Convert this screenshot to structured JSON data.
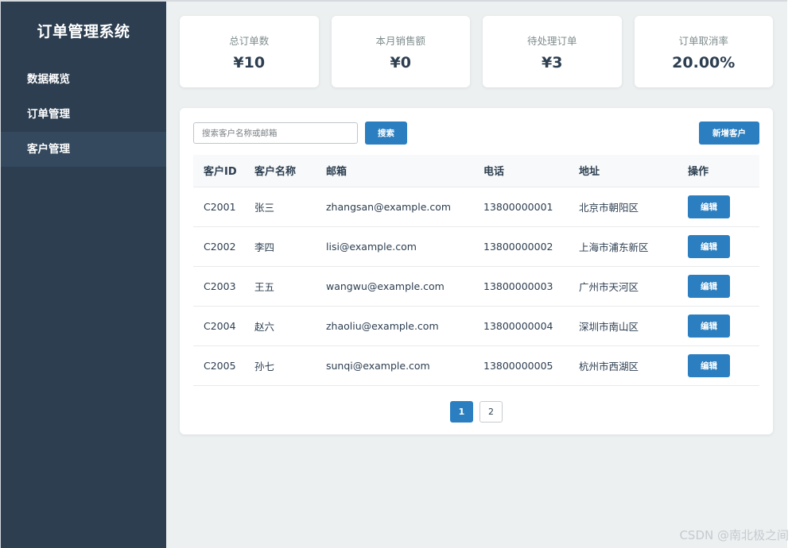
{
  "brand": "订单管理系统",
  "sidebar": {
    "items": [
      {
        "label": "数据概览"
      },
      {
        "label": "订单管理"
      },
      {
        "label": "客户管理"
      }
    ]
  },
  "stats": [
    {
      "label": "总订单数",
      "value": "¥10"
    },
    {
      "label": "本月销售额",
      "value": "¥0"
    },
    {
      "label": "待处理订单",
      "value": "¥3"
    },
    {
      "label": "订单取消率",
      "value": "20.00%"
    }
  ],
  "toolbar": {
    "search_placeholder": "搜索客户名称或邮箱",
    "search_label": "搜索",
    "add_label": "新增客户"
  },
  "table": {
    "headers": [
      "客户ID",
      "客户名称",
      "邮箱",
      "电话",
      "地址",
      "操作"
    ],
    "rows": [
      {
        "id": "C2001",
        "name": "张三",
        "email": "zhangsan@example.com",
        "phone": "13800000001",
        "address": "北京市朝阳区",
        "action": "编辑"
      },
      {
        "id": "C2002",
        "name": "李四",
        "email": "lisi@example.com",
        "phone": "13800000002",
        "address": "上海市浦东新区",
        "action": "编辑"
      },
      {
        "id": "C2003",
        "name": "王五",
        "email": "wangwu@example.com",
        "phone": "13800000003",
        "address": "广州市天河区",
        "action": "编辑"
      },
      {
        "id": "C2004",
        "name": "赵六",
        "email": "zhaoliu@example.com",
        "phone": "13800000004",
        "address": "深圳市南山区",
        "action": "编辑"
      },
      {
        "id": "C2005",
        "name": "孙七",
        "email": "sunqi@example.com",
        "phone": "13800000005",
        "address": "杭州市西湖区",
        "action": "编辑"
      }
    ]
  },
  "pagination": {
    "pages": [
      "1",
      "2"
    ],
    "current": "1"
  },
  "watermark": "CSDN @南北极之间",
  "colors": {
    "sidebar_bg": "#2c3e50",
    "sidebar_active": "#34495e",
    "accent": "#2b7fc0",
    "content_bg": "#ecf0f1"
  }
}
